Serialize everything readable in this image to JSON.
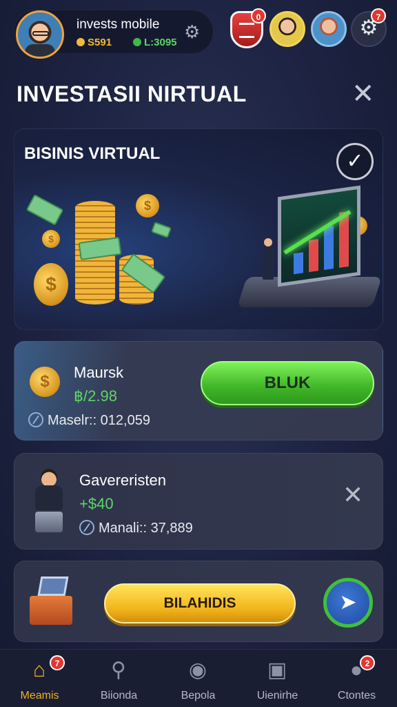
{
  "header": {
    "app_name": "invests mobile",
    "stat_coins": "S591",
    "stat_cash": "L:3095",
    "shield_badge": "0",
    "settings_badge": "7"
  },
  "page": {
    "title": "INVESTASII NIRTUAL"
  },
  "hero": {
    "title": "BISINIS VIRTUAL"
  },
  "cards": [
    {
      "name": "Maursk",
      "value": "฿/2.98",
      "meta": "Maselr:: 012,059",
      "button": "BLUK"
    },
    {
      "name": "Gavereristen",
      "value": "+$40",
      "meta": "Manali:: 37,889"
    },
    {
      "button": "BILAHIDIS"
    }
  ],
  "nav": {
    "items": [
      {
        "label": "Meamis",
        "icon": "home-icon",
        "badge": "7",
        "active": true
      },
      {
        "label": "Biionda",
        "icon": "search-icon"
      },
      {
        "label": "Bepola",
        "icon": "globe-icon"
      },
      {
        "label": "Uienirhe",
        "icon": "portfolio-icon"
      },
      {
        "label": "Ctontes",
        "icon": "profile-icon",
        "badge": "2"
      }
    ]
  },
  "colors": {
    "accent_green": "#5fd468",
    "accent_gold": "#f2b11c",
    "background": "#1c2240",
    "badge_red": "#e2362f"
  }
}
